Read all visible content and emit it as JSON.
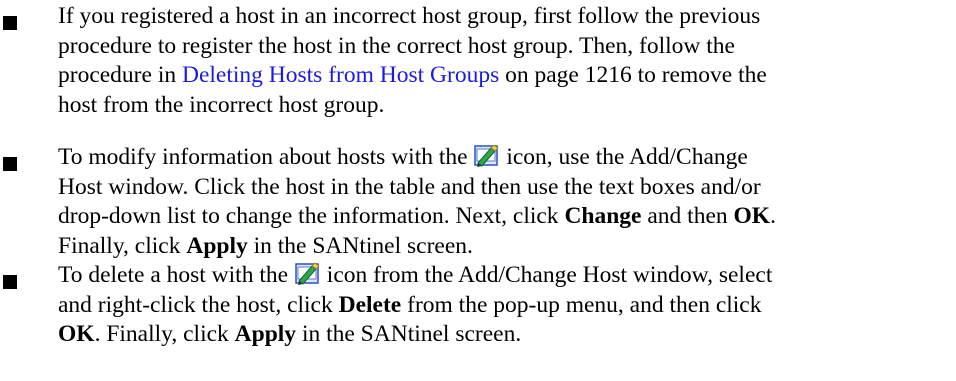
{
  "bullets": [
    {
      "lines": [
        [
          "If you registered a host in an incorrect host group, first follow the previous"
        ],
        [
          "procedure to register the host in the correct host group. Then, follow the"
        ],
        [
          "procedure in ",
          "Deleting Hosts from Host Groups",
          " on page 1216 to remove the"
        ],
        [
          "host from the incorrect host group."
        ]
      ]
    },
    {
      "lines": [
        [
          "To modify information about hosts with the ",
          " icon, use the Add/Change"
        ],
        [
          "Host window. Click the host in the table and then use the text boxes and/or"
        ],
        [
          "drop-down list to change the information. Next, click ",
          "Change",
          " and then ",
          "OK",
          "."
        ],
        [
          "Finally, click ",
          "Apply",
          " in the SANtinel screen."
        ]
      ]
    },
    {
      "lines": [
        [
          "To delete a host with the ",
          " icon from the Add/Change Host window, select"
        ],
        [
          "and right-click the host, click ",
          "Delete",
          " from the pop-up menu, and then click"
        ],
        [
          "",
          "OK",
          ". Finally, click ",
          "Apply",
          " in the SANtinel screen."
        ]
      ]
    }
  ],
  "icons": {
    "host_edit_icon": "host-edit-icon",
    "bullet_marker": "square-bullet"
  },
  "colors": {
    "link": "#1a1ae6",
    "text": "#000000",
    "icon_green": "#2aa84a",
    "icon_blue": "#2f4fd0"
  }
}
